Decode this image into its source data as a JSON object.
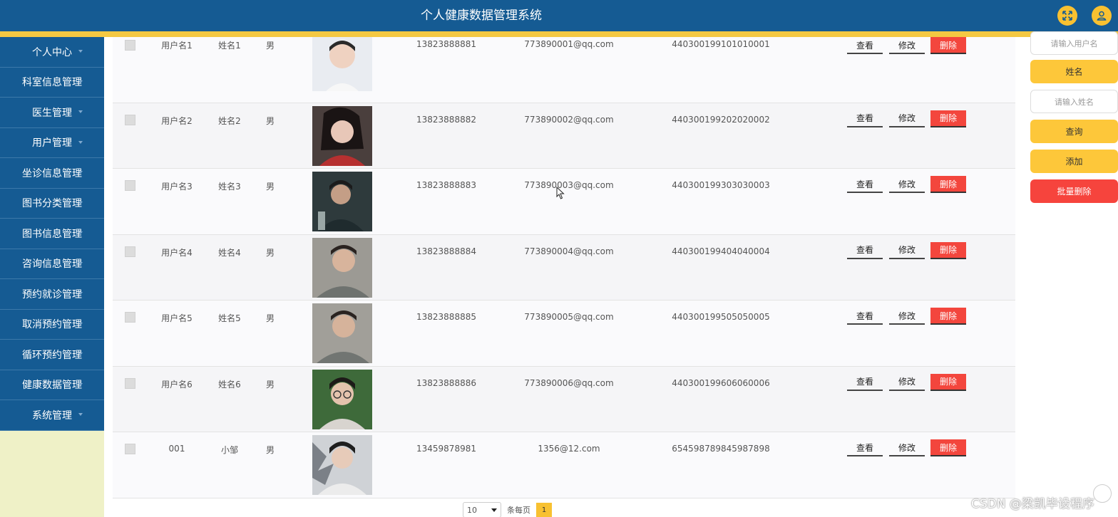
{
  "header": {
    "title": "个人健康数据管理系统"
  },
  "sidebar": {
    "items": [
      {
        "label": "个人中心"
      },
      {
        "label": "科室信息管理"
      },
      {
        "label": "医生管理"
      },
      {
        "label": "用户管理"
      },
      {
        "label": "坐诊信息管理"
      },
      {
        "label": "图书分类管理"
      },
      {
        "label": "图书信息管理"
      },
      {
        "label": "咨询信息管理"
      },
      {
        "label": "预约就诊管理"
      },
      {
        "label": "取消预约管理"
      },
      {
        "label": "循环预约管理"
      },
      {
        "label": "健康数据管理"
      },
      {
        "label": "系统管理"
      }
    ]
  },
  "table": {
    "actions": {
      "view": "查看",
      "edit": "修改",
      "delete": "删除"
    },
    "rows": [
      {
        "username": "用户名1",
        "name": "姓名1",
        "sex": "男",
        "phone": "13823888881",
        "email": "773890001@qq.com",
        "id_number": "440300199101010001"
      },
      {
        "username": "用户名2",
        "name": "姓名2",
        "sex": "男",
        "phone": "13823888882",
        "email": "773890002@qq.com",
        "id_number": "440300199202020002"
      },
      {
        "username": "用户名3",
        "name": "姓名3",
        "sex": "男",
        "phone": "13823888883",
        "email": "773890003@qq.com",
        "id_number": "440300199303030003"
      },
      {
        "username": "用户名4",
        "name": "姓名4",
        "sex": "男",
        "phone": "13823888884",
        "email": "773890004@qq.com",
        "id_number": "440300199404040004"
      },
      {
        "username": "用户名5",
        "name": "姓名5",
        "sex": "男",
        "phone": "13823888885",
        "email": "773890005@qq.com",
        "id_number": "440300199505050005"
      },
      {
        "username": "用户名6",
        "name": "姓名6",
        "sex": "男",
        "phone": "13823888886",
        "email": "773890006@qq.com",
        "id_number": "440300199606060006"
      },
      {
        "username": "001",
        "name": "小邹",
        "sex": "男",
        "phone": "13459878981",
        "email": "1356@12.com",
        "id_number": "654598789845987898"
      }
    ]
  },
  "pagination": {
    "page_size": "10",
    "per_page_label": "条每页",
    "current_page": "1"
  },
  "search": {
    "username_placeholder": "请输入用户名",
    "name_label": "姓名",
    "name_placeholder": "请输入姓名",
    "query_label": "查询",
    "add_label": "添加",
    "batch_delete_label": "批量删除"
  },
  "watermark": "CSDN @梁凯毕设程序",
  "colors": {
    "primary": "#155b93",
    "accent": "#f8c131",
    "danger": "#f3463d",
    "sidebar_bg": "#eff1c7"
  }
}
